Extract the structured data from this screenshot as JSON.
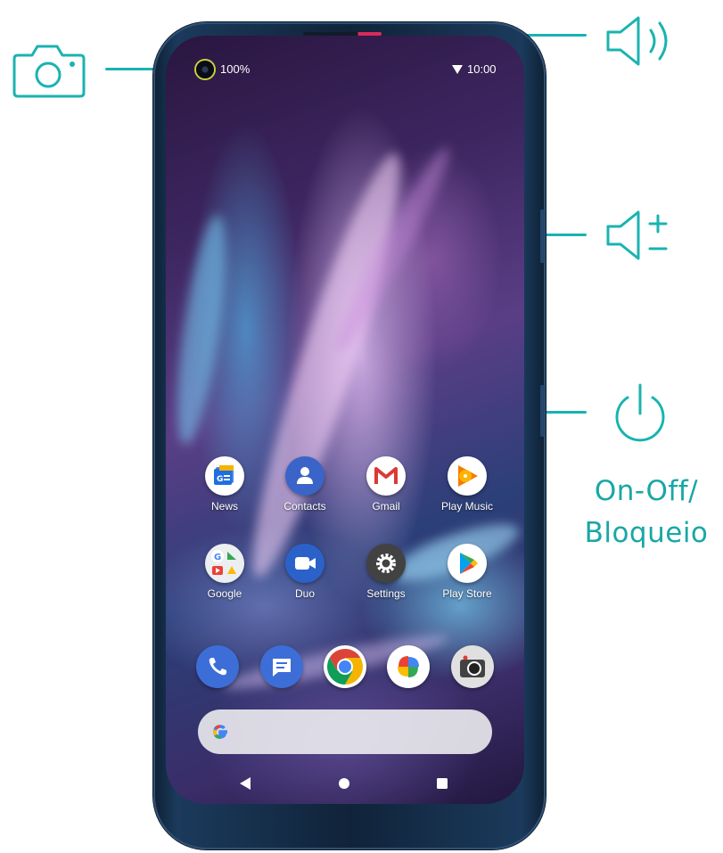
{
  "callouts": {
    "power_label_line1": "On-Off/",
    "power_label_line2": "Bloqueio"
  },
  "status_bar": {
    "battery": "100%",
    "time": "10:00"
  },
  "apps": [
    {
      "label": "News"
    },
    {
      "label": "Contacts"
    },
    {
      "label": "Gmail"
    },
    {
      "label": "Play Music"
    },
    {
      "label": "Google"
    },
    {
      "label": "Duo"
    },
    {
      "label": "Settings"
    },
    {
      "label": "Play Store"
    }
  ],
  "colors": {
    "accent": "#19b3b1",
    "phone_body": "#1b3a5c"
  },
  "icons": [
    "camera-icon",
    "speaker-icon",
    "volume-icon",
    "power-icon",
    "wifi-icon",
    "back-icon",
    "home-icon",
    "recents-icon"
  ]
}
